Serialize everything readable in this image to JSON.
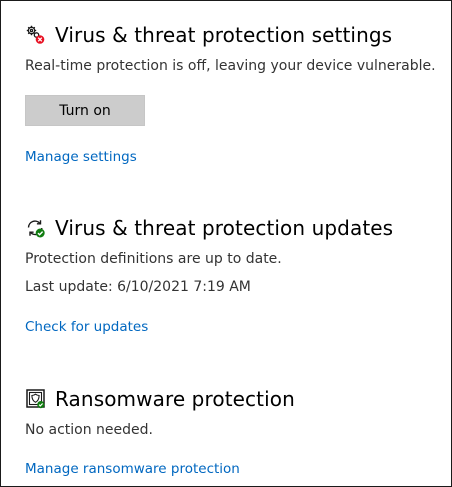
{
  "settings": {
    "icon": "gear-warning-icon",
    "title": "Virus & threat protection settings",
    "description": "Real-time protection is off, leaving your device vulnerable.",
    "turn_on_label": "Turn on",
    "manage_link": "Manage settings",
    "warning_color": "#e81123"
  },
  "updates": {
    "icon": "refresh-check-icon",
    "title": "Virus & threat protection updates",
    "status": "Protection definitions are up to date.",
    "last_update": "Last update: 6/10/2021 7:19 AM",
    "check_link": "Check for updates",
    "ok_color": "#107c10"
  },
  "ransomware": {
    "icon": "ransomware-shield-icon",
    "title": "Ransomware protection",
    "status": "No action needed.",
    "manage_link": "Manage ransomware protection"
  },
  "colors": {
    "link": "#0067c0",
    "button_bg": "#cccccc"
  }
}
